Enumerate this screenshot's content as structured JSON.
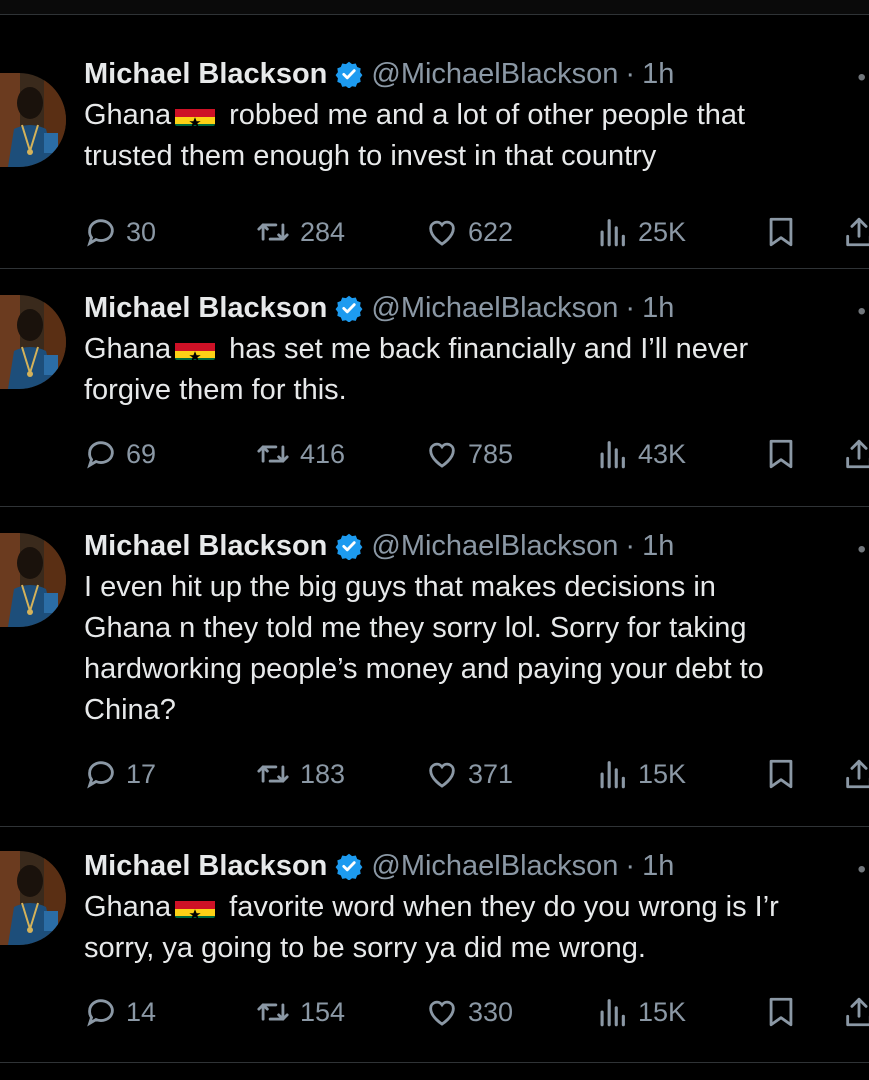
{
  "colors": {
    "background": "#000000",
    "text": "#e7e9ea",
    "muted": "#8b98a5",
    "verified": "#1d9bf0",
    "divider": "#2f3336"
  },
  "tweets": [
    {
      "name": "Michael Blackson",
      "handle": "@MichaelBlackson",
      "separator": "·",
      "time": "1h",
      "text_before_flag": "Ghana",
      "text_after_flag": " robbed me and a lot of other people that\ntrusted them enough to invest in that country",
      "replies": "30",
      "reposts": "284",
      "likes": "622",
      "views": "25K"
    },
    {
      "name": "Michael Blackson",
      "handle": "@MichaelBlackson",
      "separator": "·",
      "time": "1h",
      "text_before_flag": "Ghana",
      "text_after_flag": " has set me back financially and I’ll never\nforgive them for this.",
      "replies": "69",
      "reposts": "416",
      "likes": "785",
      "views": "43K"
    },
    {
      "name": "Michael Blackson",
      "handle": "@MichaelBlackson",
      "separator": "·",
      "time": "1h",
      "text_before_flag": "",
      "text_after_flag": "I even hit up the big guys that makes decisions in\nGhana n they told me they sorry lol. Sorry for taking\nhardworking people’s money and paying your debt to\nChina?",
      "replies": "17",
      "reposts": "183",
      "likes": "371",
      "views": "15K"
    },
    {
      "name": "Michael Blackson",
      "handle": "@MichaelBlackson",
      "separator": "·",
      "time": "1h",
      "text_before_flag": "Ghana",
      "text_after_flag": " favorite word when they do you wrong is I’r\nsorry, ya going to be sorry ya did me wrong.",
      "replies": "14",
      "reposts": "154",
      "likes": "330",
      "views": "15K"
    }
  ],
  "icons": {
    "more": "more-icon",
    "reply": "reply-icon",
    "repost": "repost-icon",
    "like": "like-icon",
    "views": "views-icon",
    "bookmark": "bookmark-icon",
    "share": "share-icon",
    "verified": "verified-badge-icon",
    "flag": "ghana-flag-icon"
  }
}
